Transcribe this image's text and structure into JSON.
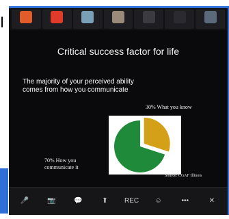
{
  "fragments": {
    "left": "I",
    "right": "s"
  },
  "participants": [
    {
      "name": "",
      "color": "#e25b2a"
    },
    {
      "name": "",
      "color": "#e03a2a"
    },
    {
      "name": "",
      "color": "#7aa0b8"
    },
    {
      "name": "",
      "color": "#9a8a7a"
    },
    {
      "name": "",
      "color": "#3a3a40"
    },
    {
      "name": "",
      "color": "#2a2a30"
    },
    {
      "name": "",
      "color": "#5a6a7a"
    }
  ],
  "slide": {
    "title": "Critical success factor for life",
    "body": "The majority of your perceived ability comes from how you communicate",
    "label_know": "30% What you know",
    "label_how": "70% How you communicate it",
    "source": "Source: CGAF Illinois"
  },
  "chart_data": {
    "type": "pie",
    "categories": [
      "How you communicate it",
      "What you know"
    ],
    "values": [
      70,
      30
    ],
    "colors": [
      "#1f8a3a",
      "#d4a017"
    ]
  },
  "toolbar": [
    {
      "icon": "mic-icon",
      "glyph": "🎤",
      "label": ""
    },
    {
      "icon": "video-icon",
      "glyph": "📷",
      "label": ""
    },
    {
      "icon": "chat-icon",
      "glyph": "💬",
      "label": ""
    },
    {
      "icon": "share-icon",
      "glyph": "⬆",
      "label": ""
    },
    {
      "icon": "record-icon",
      "glyph": "REC",
      "label": ""
    },
    {
      "icon": "reactions-icon",
      "glyph": "☺",
      "label": ""
    },
    {
      "icon": "more-icon",
      "glyph": "•••",
      "label": ""
    },
    {
      "icon": "end-icon",
      "glyph": "✕",
      "label": ""
    }
  ]
}
